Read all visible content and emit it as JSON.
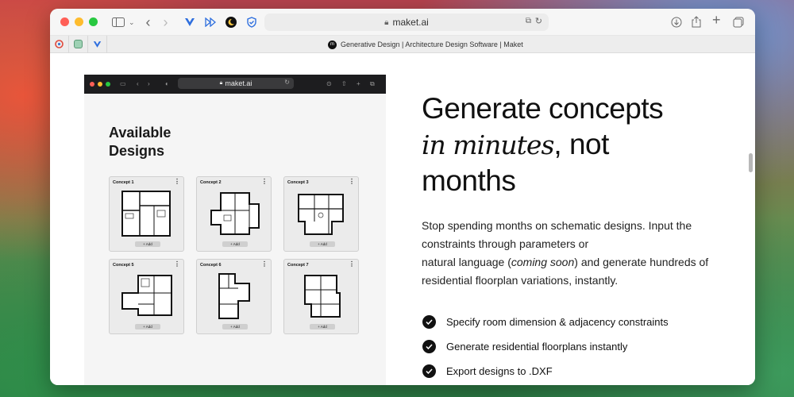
{
  "browser": {
    "url": "maket.ai",
    "tab_title": "Generative Design | Architecture Design Software | Maket",
    "tab_favicon_text": "m"
  },
  "inner_screenshot": {
    "url": "maket.ai",
    "heading_line1": "Available",
    "heading_line2": "Designs",
    "cards": [
      {
        "name": "Concept 1",
        "add_label": "+ Add",
        "menu": "⋮"
      },
      {
        "name": "Concept 2",
        "add_label": "+ Add",
        "menu": "⋮"
      },
      {
        "name": "Concept 3",
        "add_label": "+ Add",
        "menu": "⋮"
      },
      {
        "name": "Concept 5",
        "add_label": "+ Add",
        "menu": "⋮"
      },
      {
        "name": "Concept 6",
        "add_label": "+ Add",
        "menu": "⋮"
      },
      {
        "name": "Concept 7",
        "add_label": "+ Add",
        "menu": "⋮"
      }
    ]
  },
  "hero": {
    "line1": "Generate concepts",
    "line2_italic": "in minutes",
    "line2_rest": ", not",
    "line3": "months"
  },
  "description": {
    "part1": "Stop spending months on schematic designs. Input the constraints through parameters or",
    "part2": "natural language (",
    "part2_italic": "coming soon",
    "part3": ") and generate hundreds of residential floorplan variations, instantly."
  },
  "features": [
    "Specify room dimension & adjacency constraints",
    "Generate residential floorplans instantly",
    "Export designs to .DXF"
  ],
  "colors": {
    "close": "#ff5f57",
    "minimize": "#febc2e",
    "zoom": "#28c840",
    "accent_blue": "#2f6fde"
  }
}
